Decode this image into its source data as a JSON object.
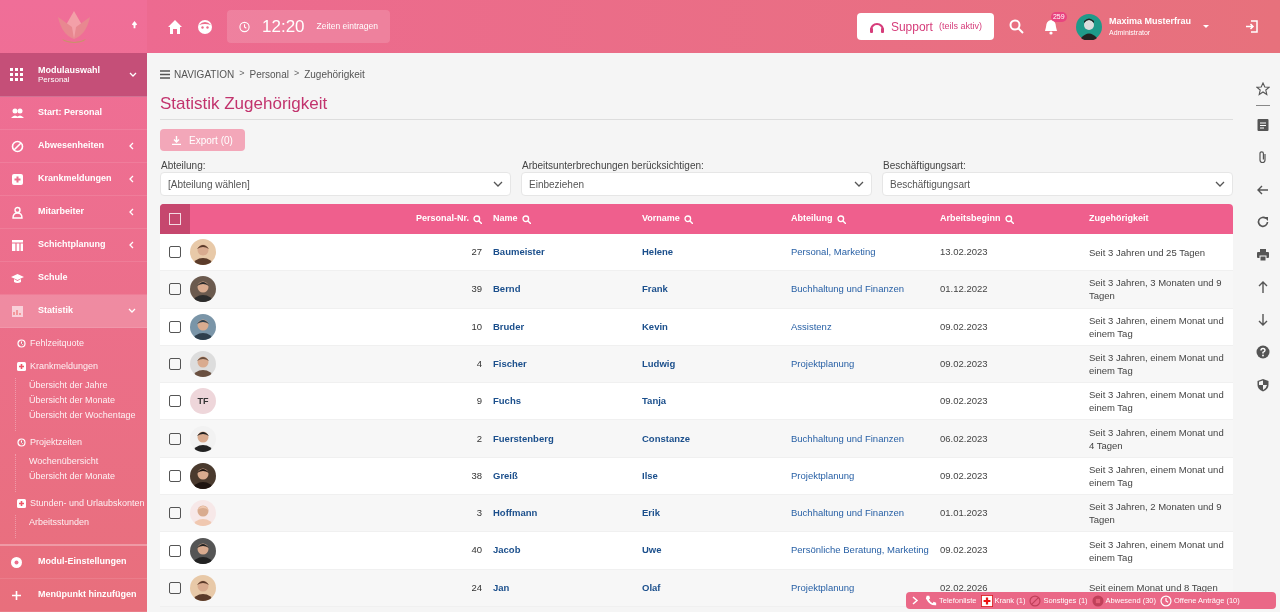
{
  "topbar": {
    "clock": "12:20",
    "clock_action": "Zeiten eintragen",
    "support": "Support",
    "support_note": "(teils aktiv)",
    "notifications": "259",
    "user": {
      "name": "Maxima Musterfrau",
      "role": "Administrator"
    }
  },
  "sidebar": {
    "module": {
      "title": "Modulauswahl",
      "subtitle": "Personal",
      "expanded": true
    },
    "items": [
      {
        "label": "Start: Personal",
        "selected": false
      },
      {
        "label": "Abwesenheiten",
        "selected": false,
        "expanded": false
      },
      {
        "label": "Krankmeldungen",
        "selected": false,
        "expanded": false
      },
      {
        "label": "Mitarbeiter",
        "selected": false,
        "expanded": false
      },
      {
        "label": "Schichtplanung",
        "selected": false,
        "expanded": false
      },
      {
        "label": "Schule",
        "selected": false
      },
      {
        "label": "Statistik",
        "selected": true,
        "expanded": true,
        "children": [
          {
            "label": "Fehlzeitquote"
          },
          {
            "label": "Krankmeldungen",
            "children": [
              {
                "label": "Übersicht der Jahre"
              },
              {
                "label": "Übersicht der Monate"
              },
              {
                "label": "Übersicht der Wochentage"
              }
            ]
          },
          {
            "label": "Projektzeiten",
            "children": [
              {
                "label": "Wochenübersicht"
              },
              {
                "label": "Übersicht der Monate"
              }
            ]
          },
          {
            "label": "Stunden- und Urlaubskonten",
            "children": [
              {
                "label": "Arbeitsstunden"
              }
            ]
          }
        ]
      }
    ],
    "footer": [
      {
        "label": "Modul-Einstellungen"
      },
      {
        "label": "Menüpunkt hinzufügen"
      }
    ]
  },
  "breadcrumb": [
    {
      "kind": "link",
      "text": "NAVIGATION"
    },
    {
      "kind": "separator",
      "text": ">"
    },
    {
      "kind": "link",
      "text": "Personal"
    },
    {
      "kind": "separator",
      "text": ">"
    },
    {
      "kind": "link",
      "text": "Zugehörigkeit"
    }
  ],
  "title": "Statistik Zugehörigkeit",
  "export": {
    "label": "Export (0)",
    "disabled": true
  },
  "filters": [
    {
      "label": "Abteilung:",
      "value": "[Abteilung wählen]"
    },
    {
      "label": "Arbeitsunterbrechungen berücksichtigen:",
      "value": "Einbeziehen"
    },
    {
      "label": "Beschäftigungsart:",
      "value": "Beschäftigungsart"
    }
  ],
  "table": {
    "select_all": {
      "checked": false
    },
    "columns": [
      {
        "label": "Personal-Nr.",
        "searchable": true
      },
      {
        "label": "Name",
        "searchable": true
      },
      {
        "label": "Vorname",
        "searchable": true
      },
      {
        "label": "Abteilung",
        "searchable": true
      },
      {
        "label": "Arbeitsbeginn",
        "searchable": true
      },
      {
        "label": "Zugehörigkeit",
        "searchable": false
      }
    ],
    "rows": [
      {
        "checked": false,
        "nr": "27",
        "name": "Baumeister",
        "first": "Helene",
        "dept": "Personal, Marketing",
        "start": "13.02.2023",
        "tenure": "Seit 3 Jahren und 25 Tagen"
      },
      {
        "checked": false,
        "nr": "39",
        "name": "Bernd",
        "first": "Frank",
        "dept": "Buchhaltung und Finanzen",
        "start": "01.12.2022",
        "tenure": "Seit 3 Jahren, 3 Monaten und 9 Tagen"
      },
      {
        "checked": false,
        "nr": "10",
        "name": "Bruder",
        "first": "Kevin",
        "dept": "Assistenz",
        "start": "09.02.2023",
        "tenure": "Seit 3 Jahren, einem Monat und einem Tag"
      },
      {
        "checked": false,
        "nr": "4",
        "name": "Fischer",
        "first": "Ludwig",
        "dept": "Projektplanung",
        "start": "09.02.2023",
        "tenure": "Seit 3 Jahren, einem Monat und einem Tag"
      },
      {
        "checked": false,
        "avatar": {
          "kind": "initials",
          "text": "TF"
        },
        "nr": "9",
        "name": "Fuchs",
        "first": "Tanja",
        "start": "09.02.2023",
        "tenure": "Seit 3 Jahren, einem Monat und einem Tag"
      },
      {
        "checked": false,
        "nr": "2",
        "name": "Fuerstenberg",
        "first": "Constanze",
        "dept": "Buchhaltung und Finanzen",
        "start": "06.02.2023",
        "tenure": "Seit 3 Jahren, einem Monat und 4 Tagen"
      },
      {
        "checked": false,
        "nr": "38",
        "name": "Greiß",
        "first": "Ilse",
        "dept": "Projektplanung",
        "start": "09.02.2023",
        "tenure": "Seit 3 Jahren, einem Monat und einem Tag"
      },
      {
        "checked": false,
        "nr": "3",
        "name": "Hoffmann",
        "first": "Erik",
        "dept": "Buchhaltung und Finanzen",
        "start": "01.01.2023",
        "tenure": "Seit 3 Jahren, 2 Monaten und 9 Tagen"
      },
      {
        "checked": false,
        "nr": "40",
        "name": "Jacob",
        "first": "Uwe",
        "dept": "Persönliche Beratung, Marketing",
        "start": "09.02.2023",
        "tenure": "Seit 3 Jahren, einem Monat und einem Tag"
      },
      {
        "checked": false,
        "nr": "24",
        "name": "Jan",
        "first": "Olaf",
        "dept": "Projektplanung",
        "start": "02.02.2026",
        "tenure": "Seit einem Monat und 8 Tagen"
      }
    ]
  },
  "statusbar": [
    {
      "kind": "phone",
      "label": "Telefonliste"
    },
    {
      "kind": "sick",
      "label": "Krank (1)"
    },
    {
      "kind": "other",
      "label": "Sonstiges (1)"
    },
    {
      "kind": "absent",
      "label": "Abwesend (30)"
    },
    {
      "kind": "requests",
      "label": "Offene Anträge (10)"
    }
  ]
}
